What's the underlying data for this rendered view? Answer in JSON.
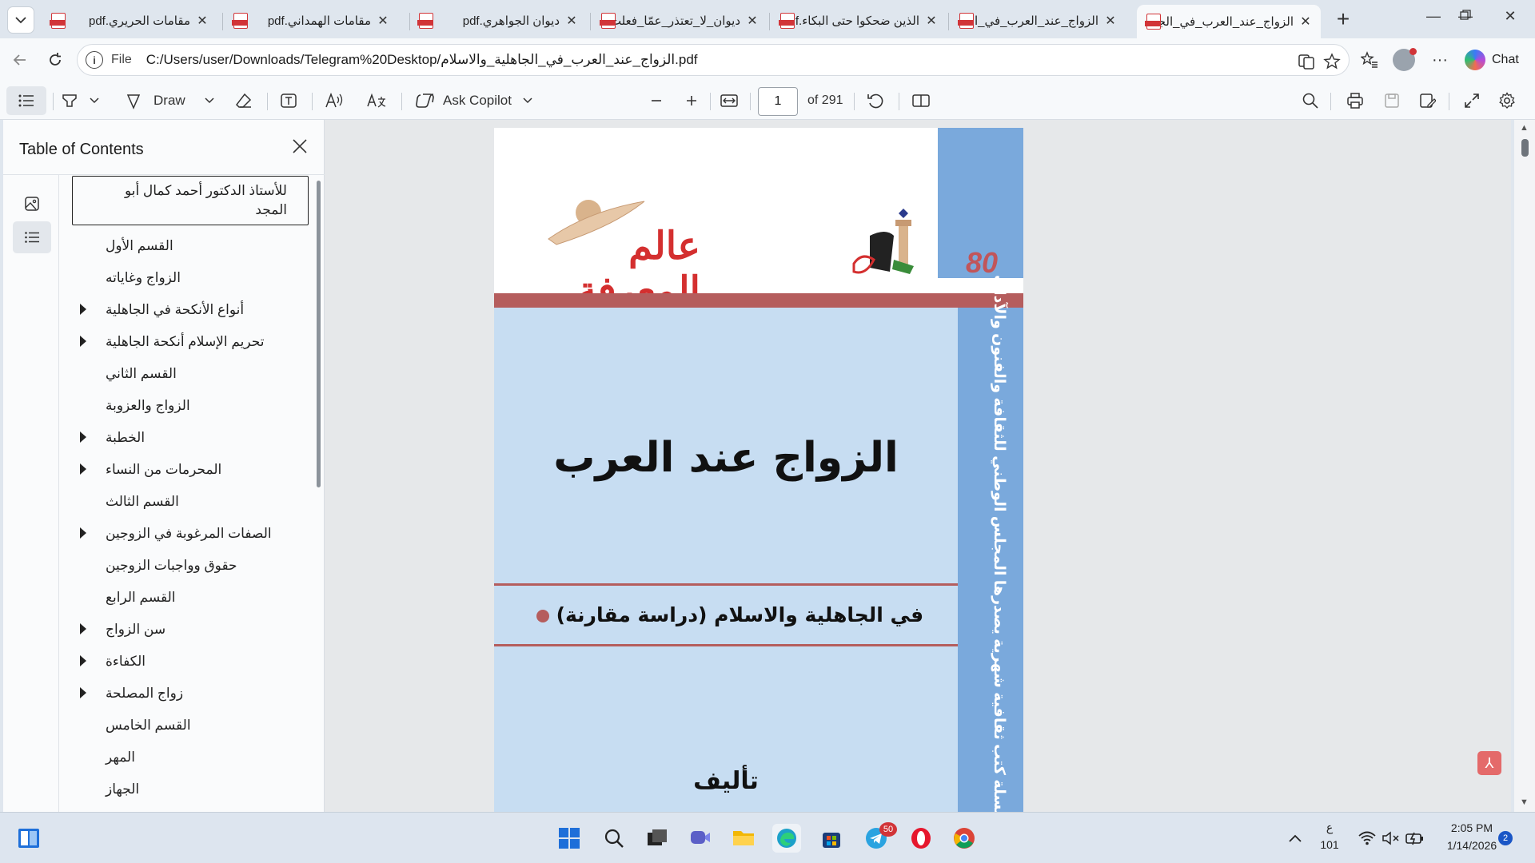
{
  "tabs": [
    {
      "title": "مقامات الحريري.pdf",
      "active": false
    },
    {
      "title": "مقامات الهمداني.pdf",
      "active": false
    },
    {
      "title": "ديوان الجواهري.pdf",
      "active": false
    },
    {
      "title": "ديوان_لا_تعتذر_عمّا_فعلت",
      "active": false
    },
    {
      "title": "الذين ضحكوا حتى البكاء.pdf",
      "active": false
    },
    {
      "title": "الزواج_عند_العرب_في_الجا",
      "active": false
    },
    {
      "title": "الزواج_عند_العرب_في_الجا",
      "active": true
    }
  ],
  "address": {
    "scheme": "File",
    "url": "C:/Users/user/Downloads/Telegram%20Desktop/الزواج_عند_العرب_في_الجاهلية_والاسلام.pdf"
  },
  "chat_label": "Chat",
  "pdf_toolbar": {
    "draw_label": "Draw",
    "copilot_label": "Ask Copilot",
    "page_current": "1",
    "page_total_label": "of 291"
  },
  "sidebar": {
    "title": "Table of Contents",
    "items": [
      {
        "label": "للأستاذ الدكتور أحمد كمال أبو المجد",
        "expandable": false
      },
      {
        "label": "القسم الأول",
        "expandable": false
      },
      {
        "label": "الزواج وغاياته",
        "expandable": false
      },
      {
        "label": "أنواع الأنكحة في الجاهلية",
        "expandable": true
      },
      {
        "label": "تحريم الإسلام أنكحة الجاهلية",
        "expandable": true
      },
      {
        "label": "القسم الثاني",
        "expandable": false
      },
      {
        "label": "الزواج والعزوبة",
        "expandable": false
      },
      {
        "label": "الخطبة",
        "expandable": true
      },
      {
        "label": "المحرمات من النساء",
        "expandable": true
      },
      {
        "label": "القسم الثالث",
        "expandable": false
      },
      {
        "label": "الصفات المرغوبة في الزوجين",
        "expandable": true
      },
      {
        "label": "حقوق وواجبات الزوجين",
        "expandable": false
      },
      {
        "label": "القسم الرابع",
        "expandable": false
      },
      {
        "label": "سن الزواج",
        "expandable": true
      },
      {
        "label": "الكفاءة",
        "expandable": true
      },
      {
        "label": "زواج المصلحة",
        "expandable": true
      },
      {
        "label": "القسم الخامس",
        "expandable": false
      },
      {
        "label": "المهر",
        "expandable": false
      },
      {
        "label": "الجهاز",
        "expandable": false
      }
    ]
  },
  "document": {
    "series_number": "80",
    "logo_text": "عالم المعرفة",
    "spine_text": "سلسلة كتب ثقافية شهرية يصدرها المجلس الوطني للثقافة والفنون والآداب",
    "title": "الزواج عند العرب",
    "subtitle": "في الجاهلية والاسلام (دراسة مقارنة)",
    "author_label": "تأليف"
  },
  "taskbar": {
    "telegram_badge": "50",
    "lang_top": "ع",
    "lang_bottom": "101",
    "time": "2:05 PM",
    "date": "1/14/2026",
    "notification_count": "2"
  },
  "colors": {
    "cover_blue": "#7aa9dc",
    "cover_light_blue": "#c7ddf2",
    "cover_red": "#b55d5d",
    "logo_red": "#d42f2f",
    "pdf_icon": "#d13438"
  }
}
